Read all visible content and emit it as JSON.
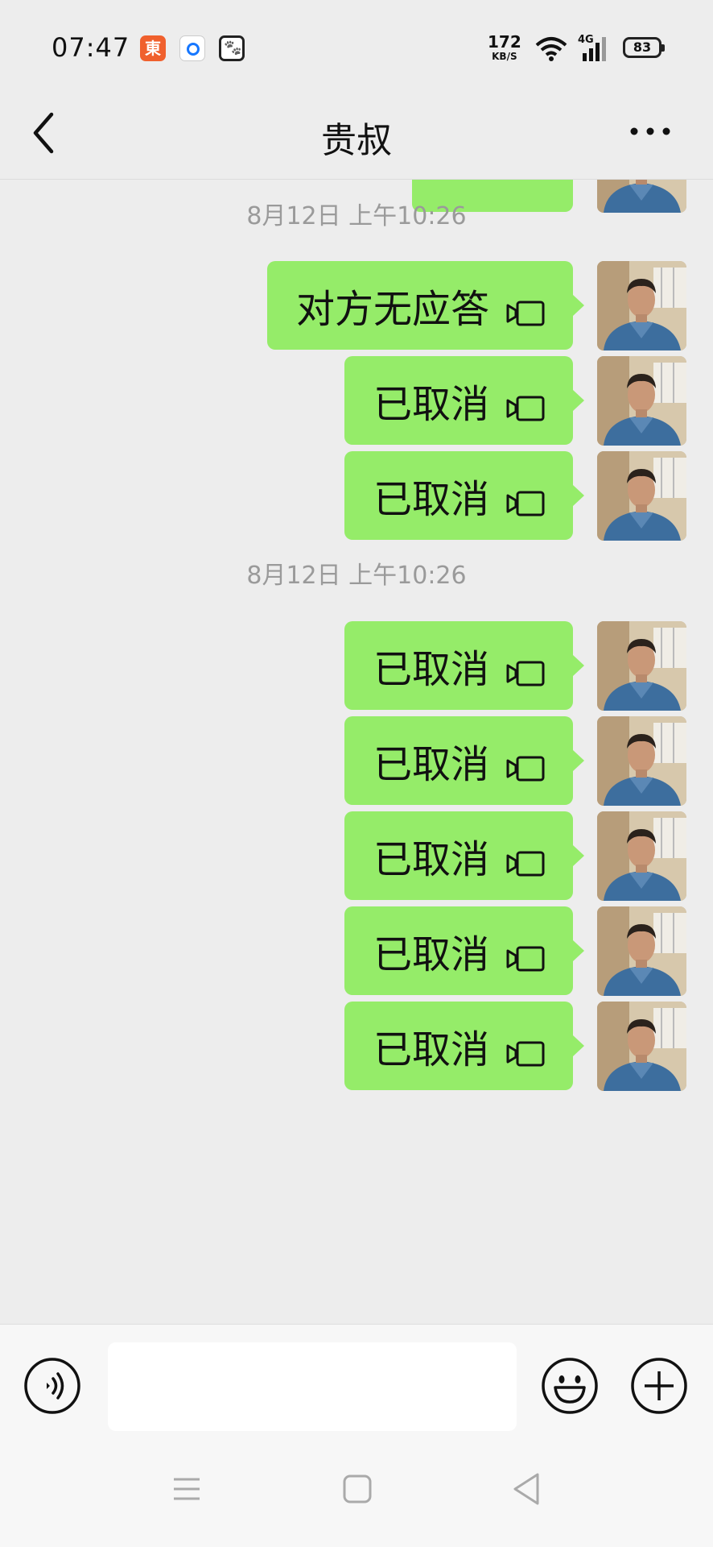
{
  "status_bar": {
    "time": "07:47",
    "app_icons": [
      "jd-icon",
      "browser-icon",
      "baidu-icon"
    ],
    "net_speed_value": "172",
    "net_speed_unit": "KB/S",
    "network": "4G",
    "battery": "83"
  },
  "header": {
    "title": "贵叔",
    "back_icon": "chevron-left-icon",
    "more_icon": "more-dots-icon"
  },
  "messages": [
    {
      "type": "timestamp",
      "text": "8月12日 上午10:26"
    },
    {
      "type": "call",
      "text": "对方无应答",
      "icon": "video-call-icon"
    },
    {
      "type": "call",
      "text": "已取消",
      "icon": "video-call-icon"
    },
    {
      "type": "call",
      "text": "已取消",
      "icon": "video-call-icon"
    },
    {
      "type": "timestamp",
      "text": "8月12日 上午10:26"
    },
    {
      "type": "call",
      "text": "已取消",
      "icon": "video-call-icon"
    },
    {
      "type": "call",
      "text": "已取消",
      "icon": "video-call-icon"
    },
    {
      "type": "call",
      "text": "已取消",
      "icon": "video-call-icon"
    },
    {
      "type": "call",
      "text": "已取消",
      "icon": "video-call-icon"
    },
    {
      "type": "call",
      "text": "已取消",
      "icon": "video-call-icon"
    }
  ],
  "input_bar": {
    "value": "",
    "placeholder": "",
    "voice_icon": "voice-icon",
    "emoji_icon": "emoji-icon",
    "plus_icon": "plus-icon"
  },
  "nav_bar": {
    "icons": [
      "menu-icon",
      "home-icon",
      "back-triangle-icon"
    ]
  },
  "colors": {
    "background": "#ededed",
    "bubble": "#95ec69",
    "timestamp": "#9a9a9a"
  }
}
